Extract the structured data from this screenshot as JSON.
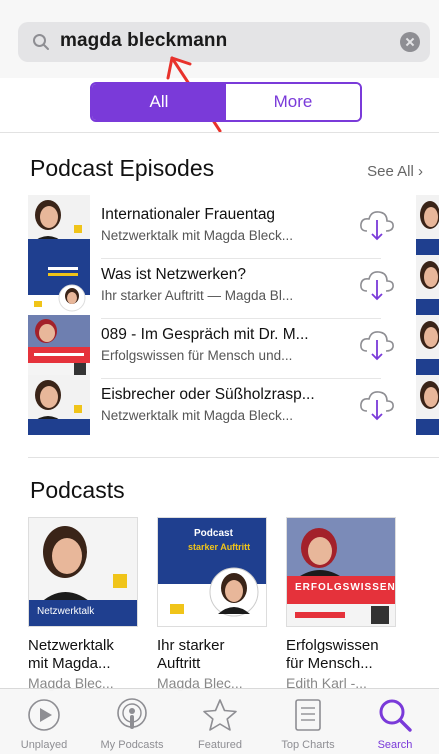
{
  "search": {
    "query": "magda bleckmann",
    "icon": "search-icon",
    "clear_icon": "clear-icon"
  },
  "segments": [
    {
      "label": "All",
      "active": true
    },
    {
      "label": "More",
      "active": false
    }
  ],
  "episodes_section": {
    "title": "Podcast Episodes",
    "see_all": "See All",
    "items": [
      {
        "title": "Internationaler Frauentag",
        "subtitle": "Netzwerktalk mit Magda Bleck..."
      },
      {
        "title": "Was ist Netzwerken?",
        "subtitle": "Ihr starker Auftritt — Magda Bl..."
      },
      {
        "title": "089 - Im Gespräch mit Dr. M...",
        "subtitle": "Erfolgswissen für Mensch und..."
      },
      {
        "title": "Eisbrecher oder Süßholzrasp...",
        "subtitle": "Netzwerktalk mit Magda Bleck..."
      }
    ]
  },
  "podcasts_section": {
    "title": "Podcasts",
    "items": [
      {
        "line1": "Netzwerktalk",
        "line2": "mit Magda...",
        "author": "Magda Blec...",
        "art_label": "Netzwerktalk"
      },
      {
        "line1": "Ihr starker",
        "line2": "Auftritt",
        "author": "Magda Blec...",
        "art_label_1": "Podcast",
        "art_label_2": "starker Auftritt"
      },
      {
        "line1": "Erfolgswissen",
        "line2": "für Mensch...",
        "author": "Edith Karl -...",
        "art_label": "ERFOLGSWISSEN"
      }
    ]
  },
  "tabbar": {
    "tabs": [
      {
        "label": "Unplayed",
        "icon": "play-circle-icon",
        "active": false
      },
      {
        "label": "My Podcasts",
        "icon": "podcasts-icon",
        "active": false
      },
      {
        "label": "Featured",
        "icon": "star-icon",
        "active": false
      },
      {
        "label": "Top Charts",
        "icon": "list-icon",
        "active": false
      },
      {
        "label": "Search",
        "icon": "search-icon",
        "active": true
      }
    ]
  },
  "colors": {
    "accent": "#7a3ad9",
    "annotation_arrow": "#e8322c"
  }
}
